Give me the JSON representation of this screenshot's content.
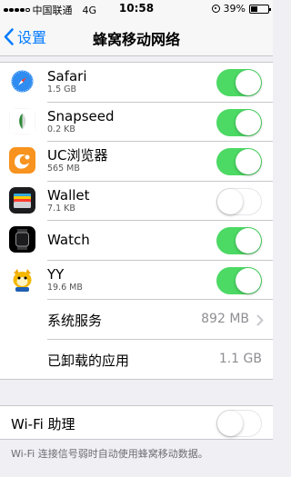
{
  "status_bar": {
    "carrier": "中国联通",
    "network": "4G",
    "time": "10:58",
    "battery": "39%",
    "battery_level": 0.39
  },
  "nav": {
    "back_label": "设置",
    "title": "蜂窝移动网络"
  },
  "apps": [
    {
      "name": "Safari",
      "size": "1.5 GB",
      "enabled": true,
      "icon": "safari-icon"
    },
    {
      "name": "Snapseed",
      "size": "0.2 KB",
      "enabled": true,
      "icon": "snapseed-icon"
    },
    {
      "name": "UC浏览器",
      "size": "565 MB",
      "enabled": true,
      "icon": "uc-browser-icon"
    },
    {
      "name": "Wallet",
      "size": "7.1 KB",
      "enabled": false,
      "icon": "wallet-icon"
    },
    {
      "name": "Watch",
      "size": "",
      "enabled": true,
      "icon": "watch-icon"
    },
    {
      "name": "YY",
      "size": "19.6 MB",
      "enabled": true,
      "icon": "yy-icon"
    }
  ],
  "system_services": {
    "label": "系统服务",
    "value": "892 MB"
  },
  "uninstalled_apps": {
    "label": "已卸载的应用",
    "value": "1.1 GB"
  },
  "wifi_assist": {
    "label": "Wi-Fi 助理",
    "enabled": false
  },
  "footer_text": "Wi-Fi 连接信号弱时自动使用蜂窝移动数据。",
  "colors": {
    "accent": "#007aff",
    "toggle_on": "#4cd964",
    "background": "#efeff4"
  }
}
